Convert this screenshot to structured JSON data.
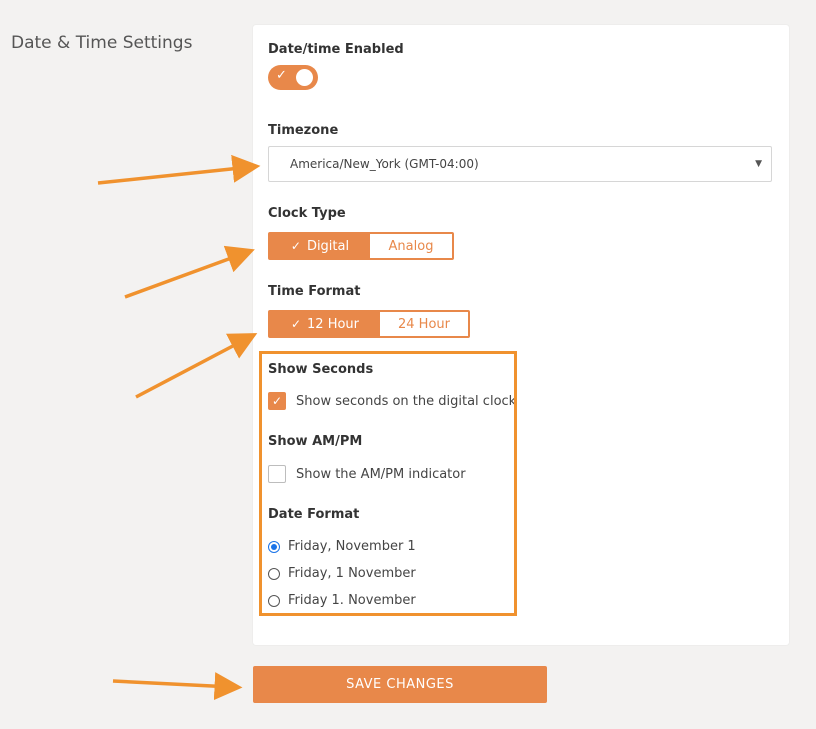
{
  "section_title": "Date & Time Settings",
  "datetime": {
    "label": "Date/time Enabled",
    "enabled": true
  },
  "timezone": {
    "label": "Timezone",
    "value": "America/New_York (GMT-04:00)"
  },
  "clock_type": {
    "label": "Clock Type",
    "options": [
      "Digital",
      "Analog"
    ],
    "selected": "Digital"
  },
  "time_format": {
    "label": "Time Format",
    "options": [
      "12 Hour",
      "24 Hour"
    ],
    "selected": "12 Hour"
  },
  "show_seconds": {
    "label": "Show Seconds",
    "checkbox_label": "Show seconds on the digital clock",
    "checked": true
  },
  "show_ampm": {
    "label": "Show AM/PM",
    "checkbox_label": "Show the AM/PM indicator",
    "checked": false
  },
  "date_format": {
    "label": "Date Format",
    "options": [
      "Friday, November 1",
      "Friday, 1 November",
      "Friday 1. November"
    ],
    "selected": "Friday, November 1"
  },
  "save_label": "SAVE CHANGES",
  "colors": {
    "accent": "#e8884a",
    "annotation": "#f0922e",
    "radio": "#1a73e8"
  }
}
